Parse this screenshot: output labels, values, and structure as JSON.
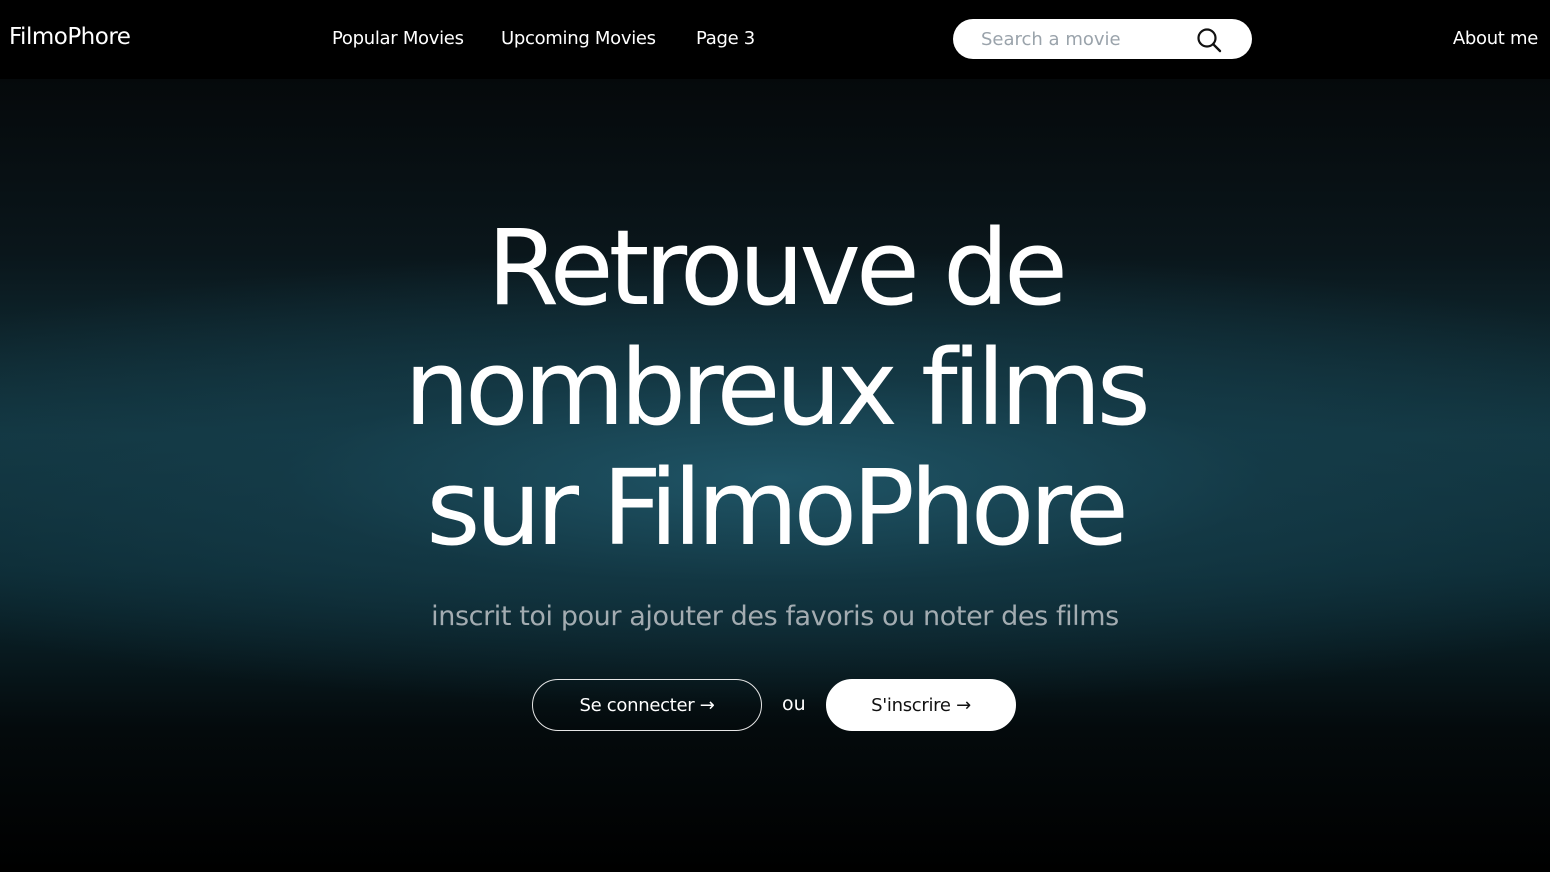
{
  "header": {
    "brand": "FilmoPhore",
    "nav": {
      "popular": "Popular Movies",
      "upcoming": "Upcoming Movies",
      "page3": "Page 3",
      "about": "About me"
    },
    "search": {
      "placeholder": "Search a movie",
      "value": "",
      "icon": "search-icon"
    }
  },
  "hero": {
    "title_lines": [
      "Retrouve de",
      "nombreux films",
      "sur FilmoPhore"
    ],
    "subtitle": "inscrit toi pour ajouter des favoris ou noter des films",
    "login_label": "Se connecter →",
    "or_label": "ou",
    "signup_label": "S'inscrire →"
  },
  "colors": {
    "navbar_bg": "#000000",
    "hero_accent": "#205668",
    "text": "#ffffff",
    "subtitle": "#a3acb1"
  }
}
